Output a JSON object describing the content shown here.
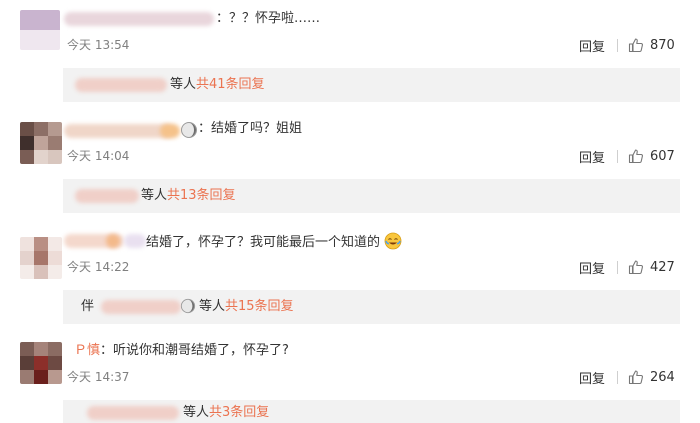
{
  "comments": [
    {
      "text": "：？？怀孕啦……",
      "time": "今天 13:54",
      "reply_label": "回复",
      "likes": "870",
      "reply_summary": {
        "suffix": "等人",
        "count_text": "共41条回复"
      }
    },
    {
      "text": "：结婚了吗？姐姐",
      "time": "今天 14:04",
      "reply_label": "回复",
      "likes": "607",
      "reply_summary": {
        "suffix": "等人",
        "count_text": "共13条回复"
      }
    },
    {
      "text": "结婚了，怀孕了？我可能最后一个知道的",
      "time": "今天 14:22",
      "reply_label": "回复",
      "likes": "427",
      "reply_summary": {
        "prefix": "伴",
        "suffix": "等人",
        "count_text": "共15条回复"
      }
    },
    {
      "name_fragment": "Ｐ慎",
      "text": "：听说你和潮哥结婚了，怀孕了?",
      "time": "今天 14:37",
      "reply_label": "回复",
      "likes": "264",
      "reply_summary": {
        "suffix": "等人",
        "count_text": "共3条回复"
      }
    }
  ],
  "icons": {
    "like": "thumbs-up-icon",
    "emoji": "crying-laughing-emoji-icon"
  },
  "colors": {
    "accent": "#eb7350",
    "reply_bg": "#f2f2f2",
    "time_gray": "#808080"
  }
}
